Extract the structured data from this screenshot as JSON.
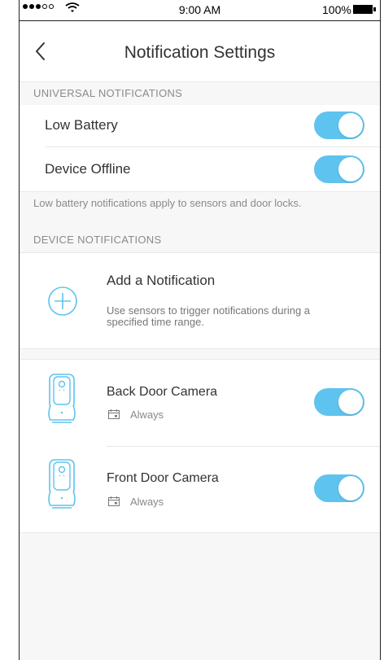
{
  "status_bar": {
    "time": "9:00 AM",
    "battery": "100%"
  },
  "nav": {
    "title": "Notification Settings"
  },
  "universal": {
    "header": "UNIVERSAL NOTIFICATIONS",
    "items": [
      {
        "label": "Low Battery",
        "enabled": true
      },
      {
        "label": "Device Offline",
        "enabled": true
      }
    ],
    "note": "Low battery notifications apply to sensors and door locks."
  },
  "device": {
    "header": "DEVICE NOTIFICATIONS",
    "add": {
      "title": "Add a Notification",
      "description": "Use sensors to trigger notifications during a specified time range."
    },
    "cameras": [
      {
        "name": "Back Door Camera",
        "schedule": "Always",
        "enabled": true
      },
      {
        "name": "Front Door Camera",
        "schedule": "Always",
        "enabled": true
      }
    ]
  },
  "colors": {
    "accent": "#5ec3ee",
    "section_bg": "#f7f7f7"
  }
}
